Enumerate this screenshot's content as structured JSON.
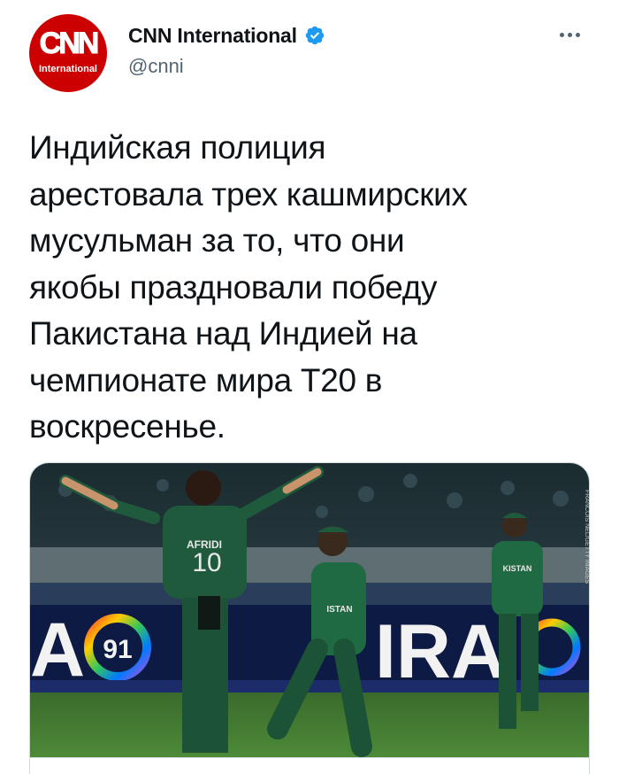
{
  "author": {
    "display_name": "CNN International",
    "handle": "@cnni",
    "avatar_logo": "CNN",
    "avatar_sub": "International",
    "verified": true,
    "avatar_color": "#cc0000",
    "verified_color": "#1d9bf0"
  },
  "tweet": {
    "text": "Индийская полиция\nарестовала трех кашмирских\nмусульман за то, что они\nякобы праздновали победу\nПакистана над Индией на\nчемпионате мира Т20 в\nвоскресенье."
  },
  "card": {
    "player_name": "AFRIDI",
    "player_number": "10",
    "jersey_text_2": "ISTAN",
    "jersey_text_3": "KISTAN",
    "billboard_text_left": "A",
    "billboard_badge": "91",
    "billboard_text_right": "IRA",
    "getty_credit": "FRANCOIS NEL/GETTY IMAGES"
  },
  "icons": {
    "verified": "verified-badge-icon",
    "more": "more-horizontal-icon"
  }
}
